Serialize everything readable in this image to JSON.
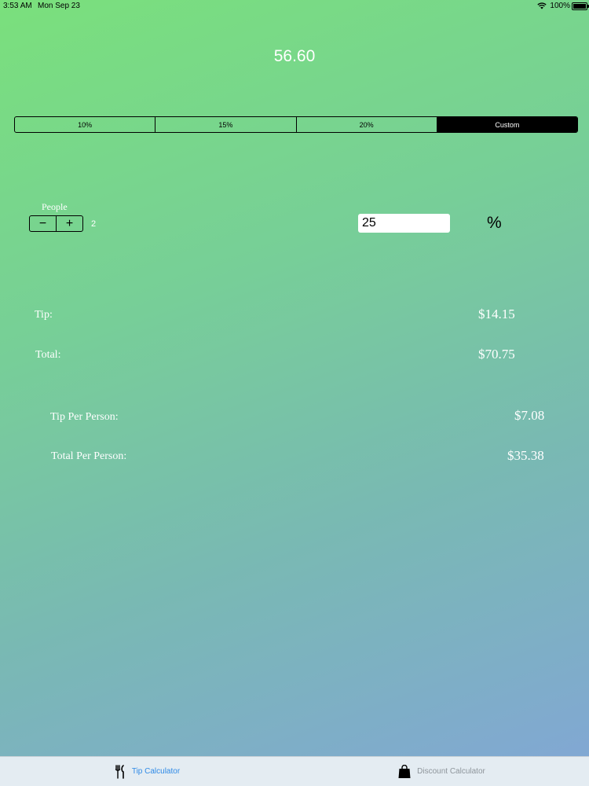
{
  "status_bar": {
    "time": "3:53 AM",
    "date": "Mon Sep 23",
    "battery": "100%"
  },
  "bill": {
    "amount": "56.60"
  },
  "tip_options": [
    {
      "label": "10%",
      "selected": false
    },
    {
      "label": "15%",
      "selected": false
    },
    {
      "label": "20%",
      "selected": false
    },
    {
      "label": "Custom",
      "selected": true
    }
  ],
  "people": {
    "label": "People",
    "minus": "−",
    "plus": "+",
    "count": "2"
  },
  "custom_tip": {
    "value": "25",
    "percent_sign": "%"
  },
  "results": {
    "tip_label": "Tip:",
    "tip_value": "$14.15",
    "total_label": "Total:",
    "total_value": "$70.75",
    "tip_pp_label": "Tip Per Person:",
    "tip_pp_value": "$7.08",
    "total_pp_label": "Total Per Person:",
    "total_pp_value": "$35.38"
  },
  "tabs": [
    {
      "label": "Tip Calculator",
      "icon": "fork-knife-icon",
      "active": true
    },
    {
      "label": "Discount Calculator",
      "icon": "shopping-bag-icon",
      "active": false
    }
  ],
  "colors": {
    "accent": "#2f8ae6",
    "inactive_tab": "#8e959b",
    "selected_segment": "#000000"
  }
}
